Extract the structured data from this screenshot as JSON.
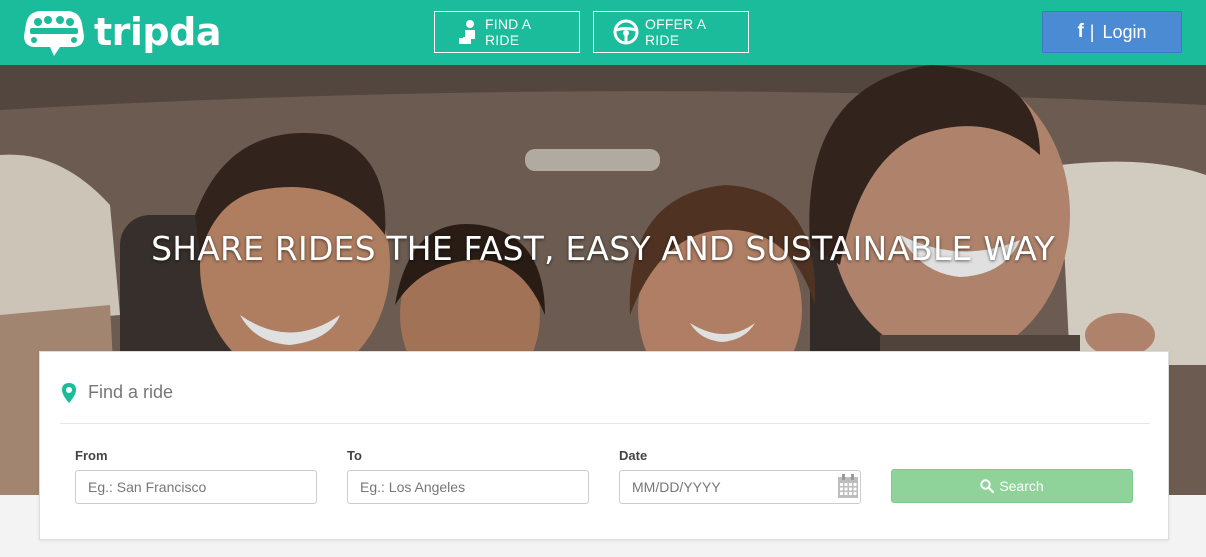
{
  "header": {
    "logo_text": "tripda",
    "find_ride_label": "FIND A RIDE",
    "offer_ride_label": "OFFER A RIDE",
    "login_fb": "f",
    "login_sep": "|",
    "login_label": "Login"
  },
  "hero": {
    "title": "SHARE RIDES THE FAST, EASY AND SUSTAINABLE WAY"
  },
  "search": {
    "title": "Find a ride",
    "from_label": "From",
    "from_placeholder": "Eg.: San Francisco",
    "to_label": "To",
    "to_placeholder": "Eg.: Los Angeles",
    "date_label": "Date",
    "date_placeholder": "MM/DD/YYYY",
    "button_label": "Search"
  },
  "colors": {
    "brand": "#1bbc9b",
    "facebook": "#4a8bd4",
    "search_button": "#8fd39a"
  },
  "icons": [
    "logo-car-icon",
    "passenger-icon",
    "steering-wheel-icon",
    "map-pin-icon",
    "calendar-icon",
    "search-icon"
  ]
}
